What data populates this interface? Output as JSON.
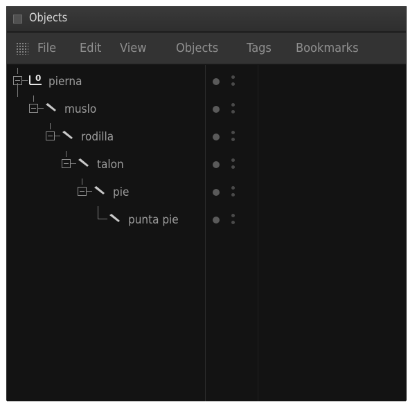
{
  "window": {
    "title": "Objects"
  },
  "menu": {
    "items": [
      "File",
      "Edit",
      "View",
      "Objects",
      "Tags",
      "Bookmarks"
    ]
  },
  "tree": {
    "objects": [
      {
        "name": "pierna",
        "icon": "null-object-icon",
        "level": 0,
        "expander": true
      },
      {
        "name": "muslo",
        "icon": "bone-icon",
        "level": 1,
        "expander": true
      },
      {
        "name": "rodilla",
        "icon": "bone-icon",
        "level": 2,
        "expander": true
      },
      {
        "name": "talon",
        "icon": "bone-icon",
        "level": 3,
        "expander": true
      },
      {
        "name": "pie",
        "icon": "bone-icon",
        "level": 4,
        "expander": true
      },
      {
        "name": "punta pie",
        "icon": "bone-icon",
        "level": 5,
        "expander": false
      }
    ]
  },
  "colors": {
    "background": "#131313",
    "titlebar": "#333333",
    "text": "#9d9d9d"
  }
}
